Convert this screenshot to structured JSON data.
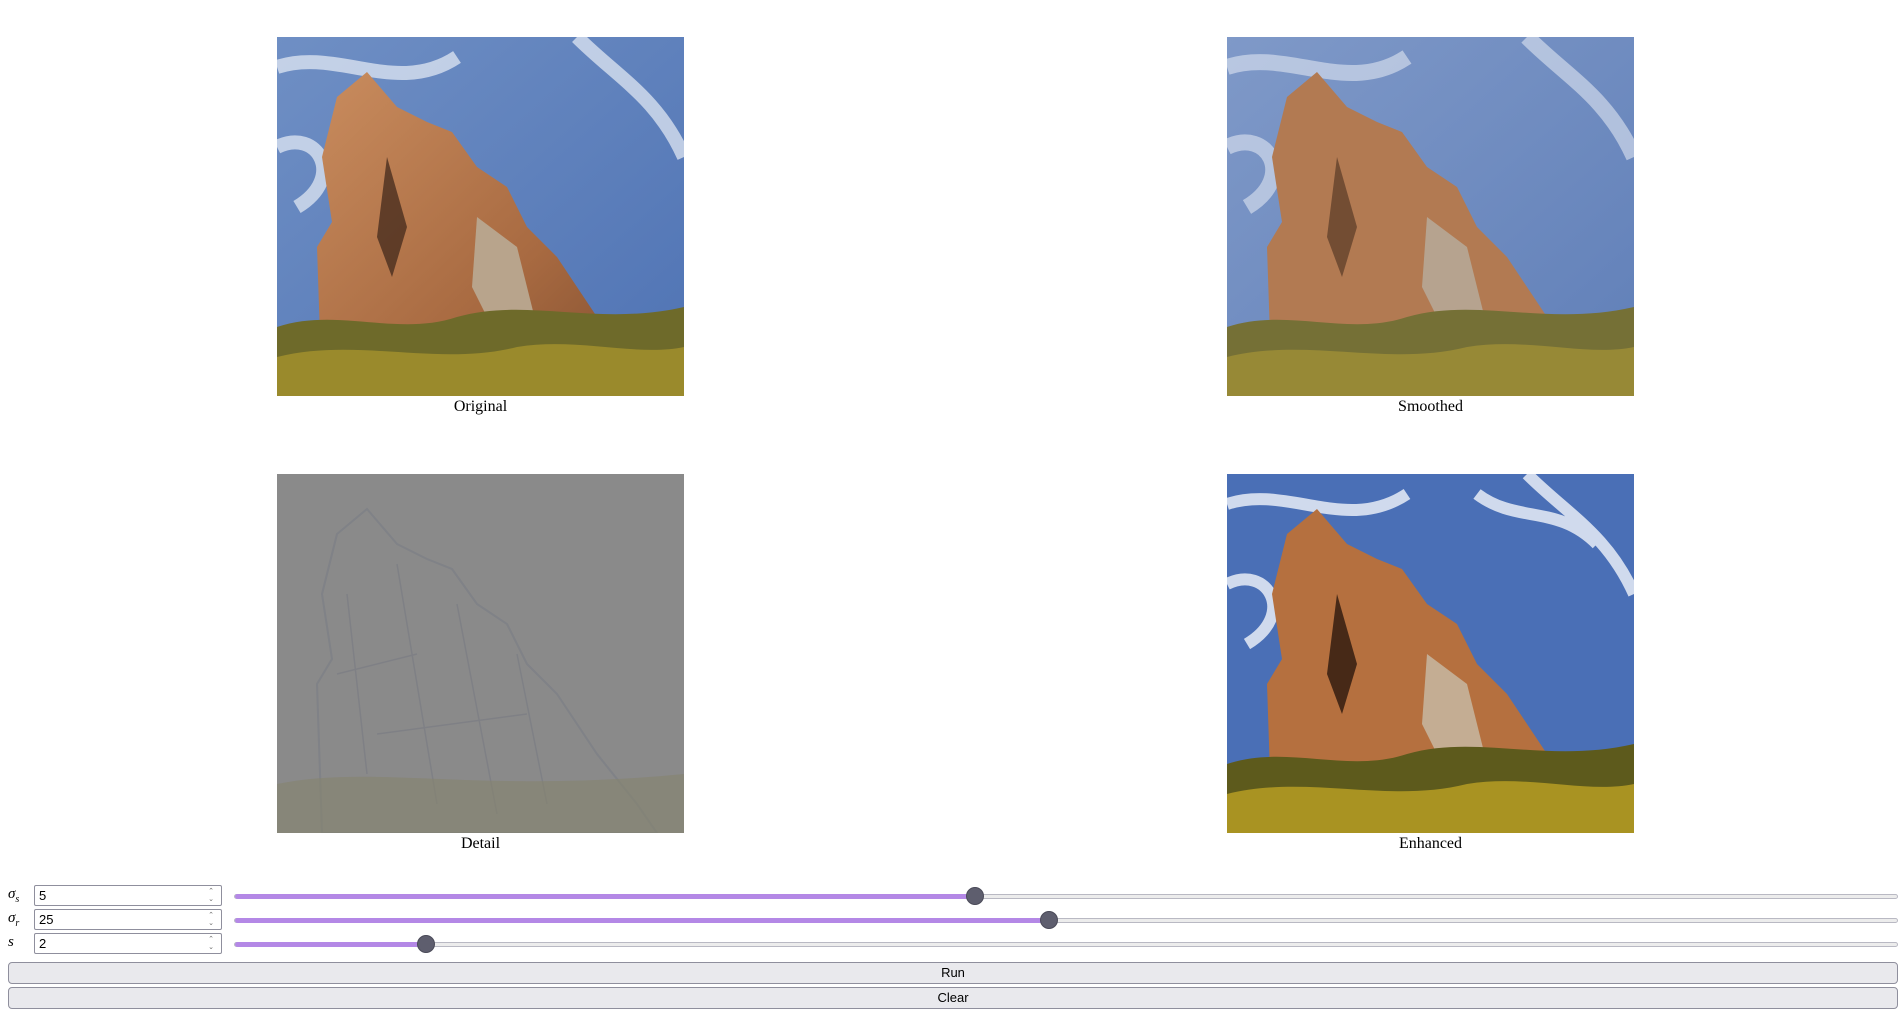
{
  "panels": {
    "original": "Original",
    "smoothed": "Smoothed",
    "detail": "Detail",
    "enhanced": "Enhanced"
  },
  "controls": [
    {
      "symbol": "σ",
      "subscript": "s",
      "value": "5",
      "slider_fraction": 0.445
    },
    {
      "symbol": "σ",
      "subscript": "r",
      "value": "25",
      "slider_fraction": 0.49
    },
    {
      "symbol": "s",
      "subscript": "",
      "value": "2",
      "slider_fraction": 0.115
    }
  ],
  "buttons": {
    "run": "Run",
    "clear": "Clear"
  },
  "colors": {
    "accent": "#b488e6",
    "thumb": "#5e5e6e"
  }
}
